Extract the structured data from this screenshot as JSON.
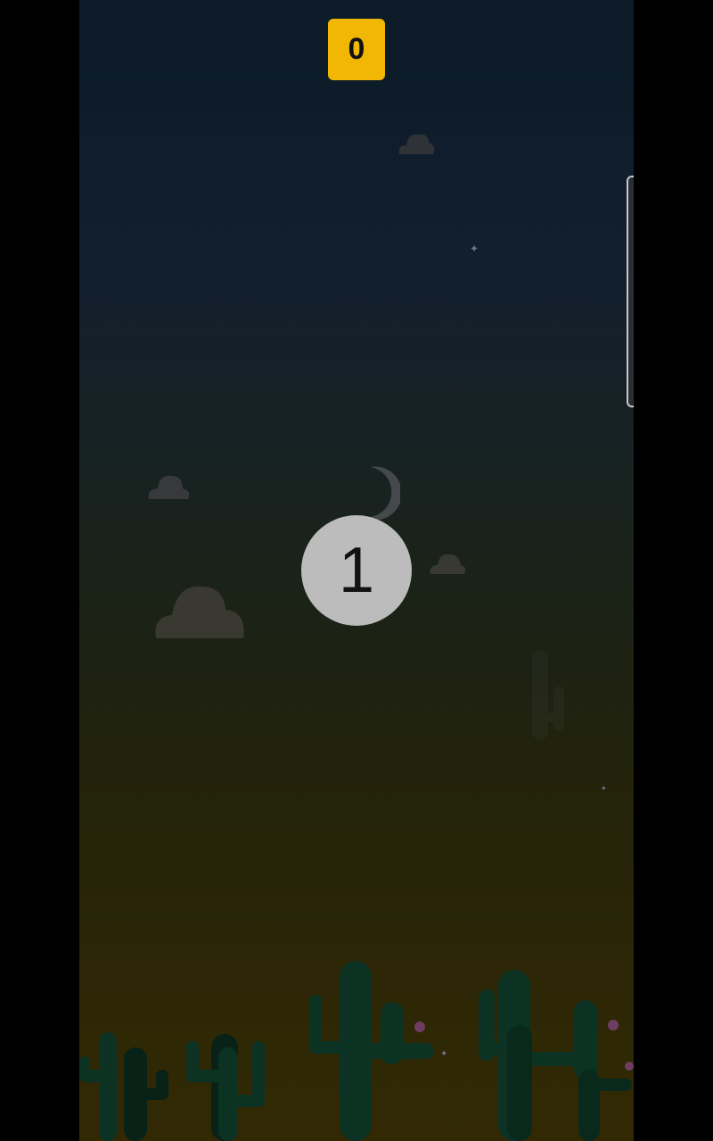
{
  "hud": {
    "score": "0",
    "score_color": "#f2b705"
  },
  "countdown": {
    "value": "1"
  },
  "scene": {
    "time_of_day": "night",
    "sky_top_color": "#0f2130",
    "sky_bottom_color": "#3d3306",
    "cactus_color": "#0f3d2b",
    "flower_color": "#8a4a78"
  }
}
